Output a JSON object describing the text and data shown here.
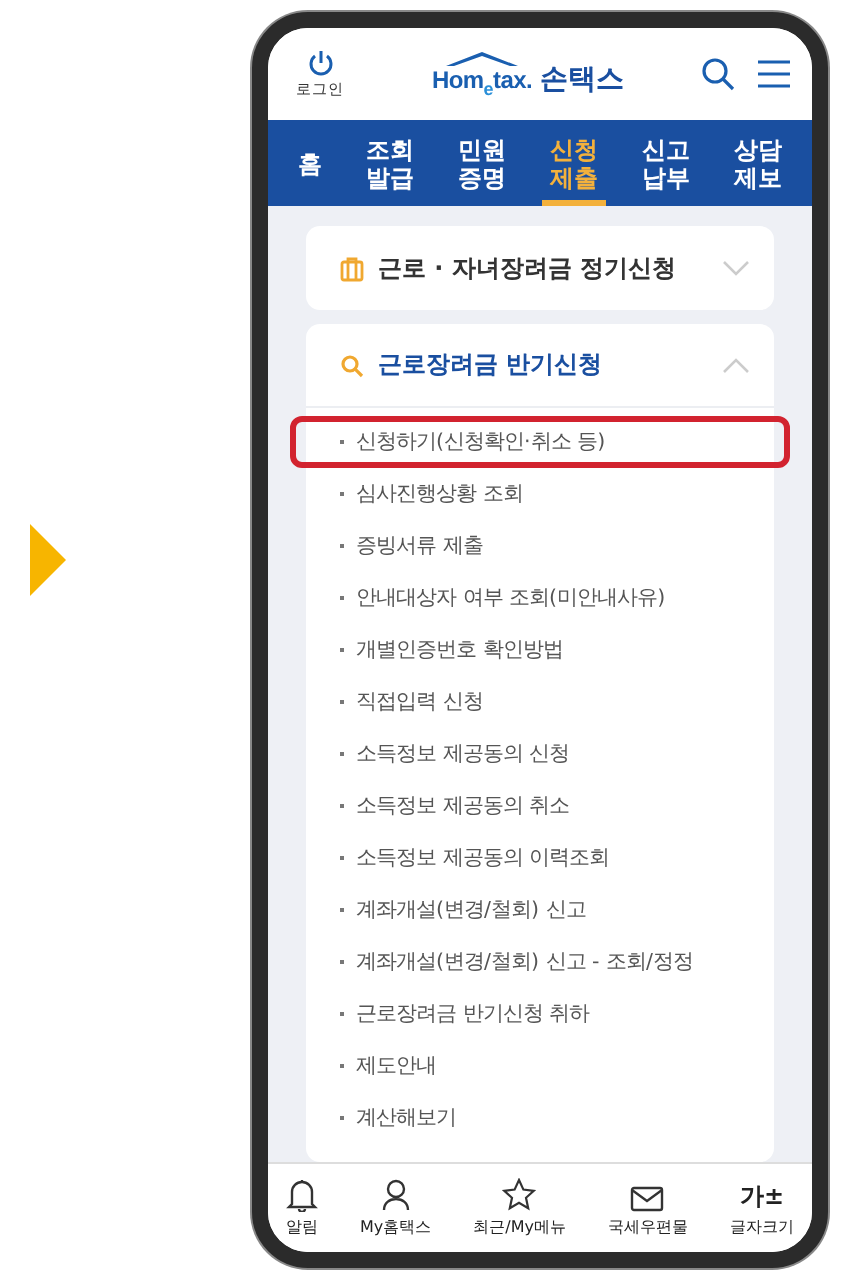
{
  "header": {
    "login": "로그인",
    "logo": "Hom$_{e}$tax.",
    "app_name": "손택스"
  },
  "tabs": [
    {
      "label": "홈",
      "selected": false
    },
    {
      "label": "조회\n발급",
      "selected": false
    },
    {
      "label": "민원\n증명",
      "selected": false
    },
    {
      "label": "신청\n제출",
      "selected": true
    },
    {
      "label": "신고\n납부",
      "selected": false
    },
    {
      "label": "상담\n제보",
      "selected": false
    }
  ],
  "sections": [
    {
      "title": "근로 · 자녀장려금 정기신청",
      "kind": "bag",
      "expanded": false
    },
    {
      "title": "근로장려금 반기신청",
      "kind": "search",
      "expanded": true,
      "items": [
        {
          "label": "신청하기(신청확인·취소 등)",
          "highlighted": true
        },
        {
          "label": "심사진행상황 조회",
          "highlighted": false
        },
        {
          "label": "증빙서류 제출",
          "highlighted": false
        },
        {
          "label": "안내대상자 여부 조회(미안내사유)",
          "highlighted": false
        },
        {
          "label": "개별인증번호 확인방법",
          "highlighted": false
        },
        {
          "label": "직접입력 신청",
          "highlighted": false
        },
        {
          "label": "소득정보 제공동의 신청",
          "highlighted": false
        },
        {
          "label": "소득정보 제공동의 취소",
          "highlighted": false
        },
        {
          "label": "소득정보 제공동의 이력조회",
          "highlighted": false
        },
        {
          "label": "계좌개설(변경/철회) 신고",
          "highlighted": false
        },
        {
          "label": "계좌개설(변경/철회) 신고 - 조회/정정",
          "highlighted": false
        },
        {
          "label": "근로장려금 반기신청 취하",
          "highlighted": false
        },
        {
          "label": "제도안내",
          "highlighted": false
        },
        {
          "label": "계산해보기",
          "highlighted": false
        }
      ]
    }
  ],
  "bottom_bar": [
    {
      "label": "알림",
      "kind": "bell"
    },
    {
      "label": "My홈택스",
      "kind": "person"
    },
    {
      "label": "최근/My메뉴",
      "kind": "star"
    },
    {
      "label": "국세우편물",
      "kind": "mail"
    },
    {
      "label": "글자크기",
      "kind": "text",
      "glyph": "가±"
    }
  ]
}
